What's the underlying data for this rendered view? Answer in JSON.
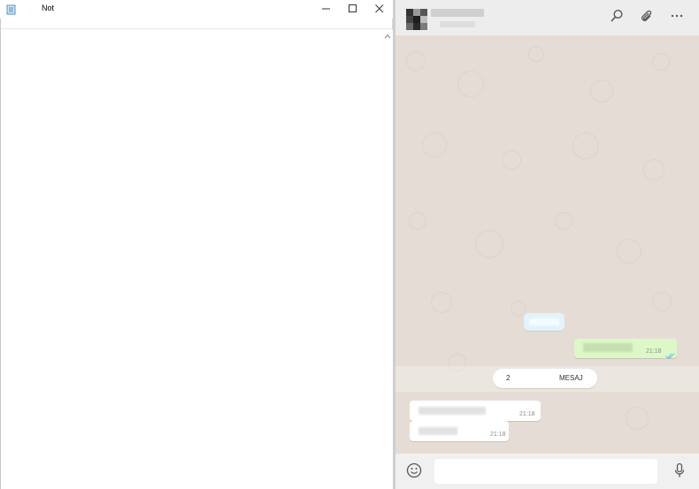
{
  "notepad": {
    "title": "Not",
    "content": "",
    "icons": {
      "app": "notepad-icon",
      "minimize": "minimize-icon",
      "maximize": "maximize-icon",
      "close": "close-icon",
      "scroll_up": "chevron-up-icon"
    }
  },
  "whatsapp": {
    "header_icons": [
      "search-icon",
      "paperclip-icon",
      "more-options-icon"
    ],
    "messages": [
      {
        "type": "system"
      },
      {
        "type": "outgoing",
        "time": "21:18",
        "status_icon": "double-check-icon"
      },
      {
        "type": "incoming",
        "time": "21:18"
      },
      {
        "type": "incoming",
        "time": "21:18"
      }
    ],
    "unread": {
      "count": "2",
      "label": "MESAJ"
    },
    "composer": {
      "emoji_icon": "emoji-icon",
      "mic_icon": "microphone-icon",
      "placeholder": ""
    }
  },
  "colors": {
    "chat_background": "#e5ddd5",
    "outgoing_bubble": "#dcf8c6",
    "incoming_bubble": "#ffffff",
    "header": "#ededed",
    "footer": "#f0f0f0",
    "read_ticks": "#4fc3f7"
  }
}
